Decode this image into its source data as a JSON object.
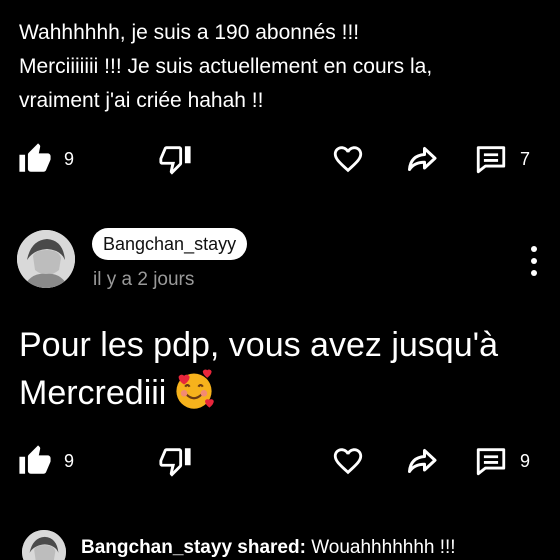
{
  "post": {
    "text": "Wahhhhhh, je suis a 190 abonnés !!!\nMerciiiiiii !!! Je suis actuellement en cours la,\nvraiment j'ai criée hahah !!"
  },
  "post_actions": {
    "likes": "9",
    "comments": "7"
  },
  "comment": {
    "author": "Bangchan_stayy",
    "time": "il y a 2 jours",
    "text": "Pour les pdp, vous avez jusqu'à Mercrediii",
    "emoji": "smiling-face-with-hearts"
  },
  "comment_actions": {
    "likes": "9",
    "comments": "9"
  },
  "shared": {
    "author_line": "Bangchan_stayy shared:",
    "text": "Wouahhhhhhh !!!"
  },
  "icons": {
    "like": "thumb-up-icon",
    "dislike": "thumb-down-icon",
    "heart": "heart-icon",
    "share": "share-arrow-icon",
    "comment": "comment-icon",
    "more": "more-vertical-icon"
  },
  "colors": {
    "background": "#000000",
    "text": "#ffffff",
    "muted": "#9a9a9a",
    "pill": "#ffffff"
  }
}
